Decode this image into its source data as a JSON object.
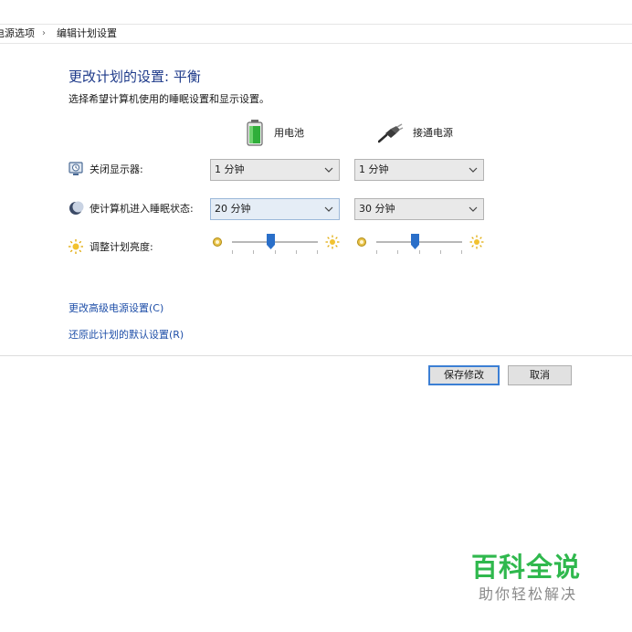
{
  "breadcrumb": {
    "items": [
      "电源选项",
      "编辑计划设置"
    ],
    "separator": "›"
  },
  "page": {
    "title": "更改计划的设置: 平衡",
    "subtitle": "选择希望计算机使用的睡眠设置和显示设置。"
  },
  "columns": {
    "battery": {
      "label": "用电池",
      "icon": "battery-icon"
    },
    "plugged": {
      "label": "接通电源",
      "icon": "power-plug-icon"
    }
  },
  "settings": {
    "display_off": {
      "label": "关闭显示器:",
      "icon": "monitor-clock-icon",
      "battery_value": "1 分钟",
      "plugged_value": "1 分钟"
    },
    "sleep": {
      "label": "使计算机进入睡眠状态:",
      "icon": "moon-sleep-icon",
      "battery_value": "20 分钟",
      "plugged_value": "30 分钟"
    },
    "brightness": {
      "label": "调整计划亮度:",
      "icon": "sun-brightness-icon",
      "battery_level": 0.45,
      "plugged_level": 0.45
    }
  },
  "links": {
    "advanced": "更改高级电源设置(C)",
    "restore": "还原此计划的默认设置(R)"
  },
  "buttons": {
    "save": "保存修改",
    "cancel": "取消"
  },
  "watermark": {
    "title": "百科全说",
    "subtitle": "助你轻松解决"
  },
  "colors": {
    "title_blue": "#1e3a8a",
    "link_blue": "#1f4fa8",
    "slider_thumb": "#2a6fc9",
    "watermark_green": "#2fb84d"
  }
}
